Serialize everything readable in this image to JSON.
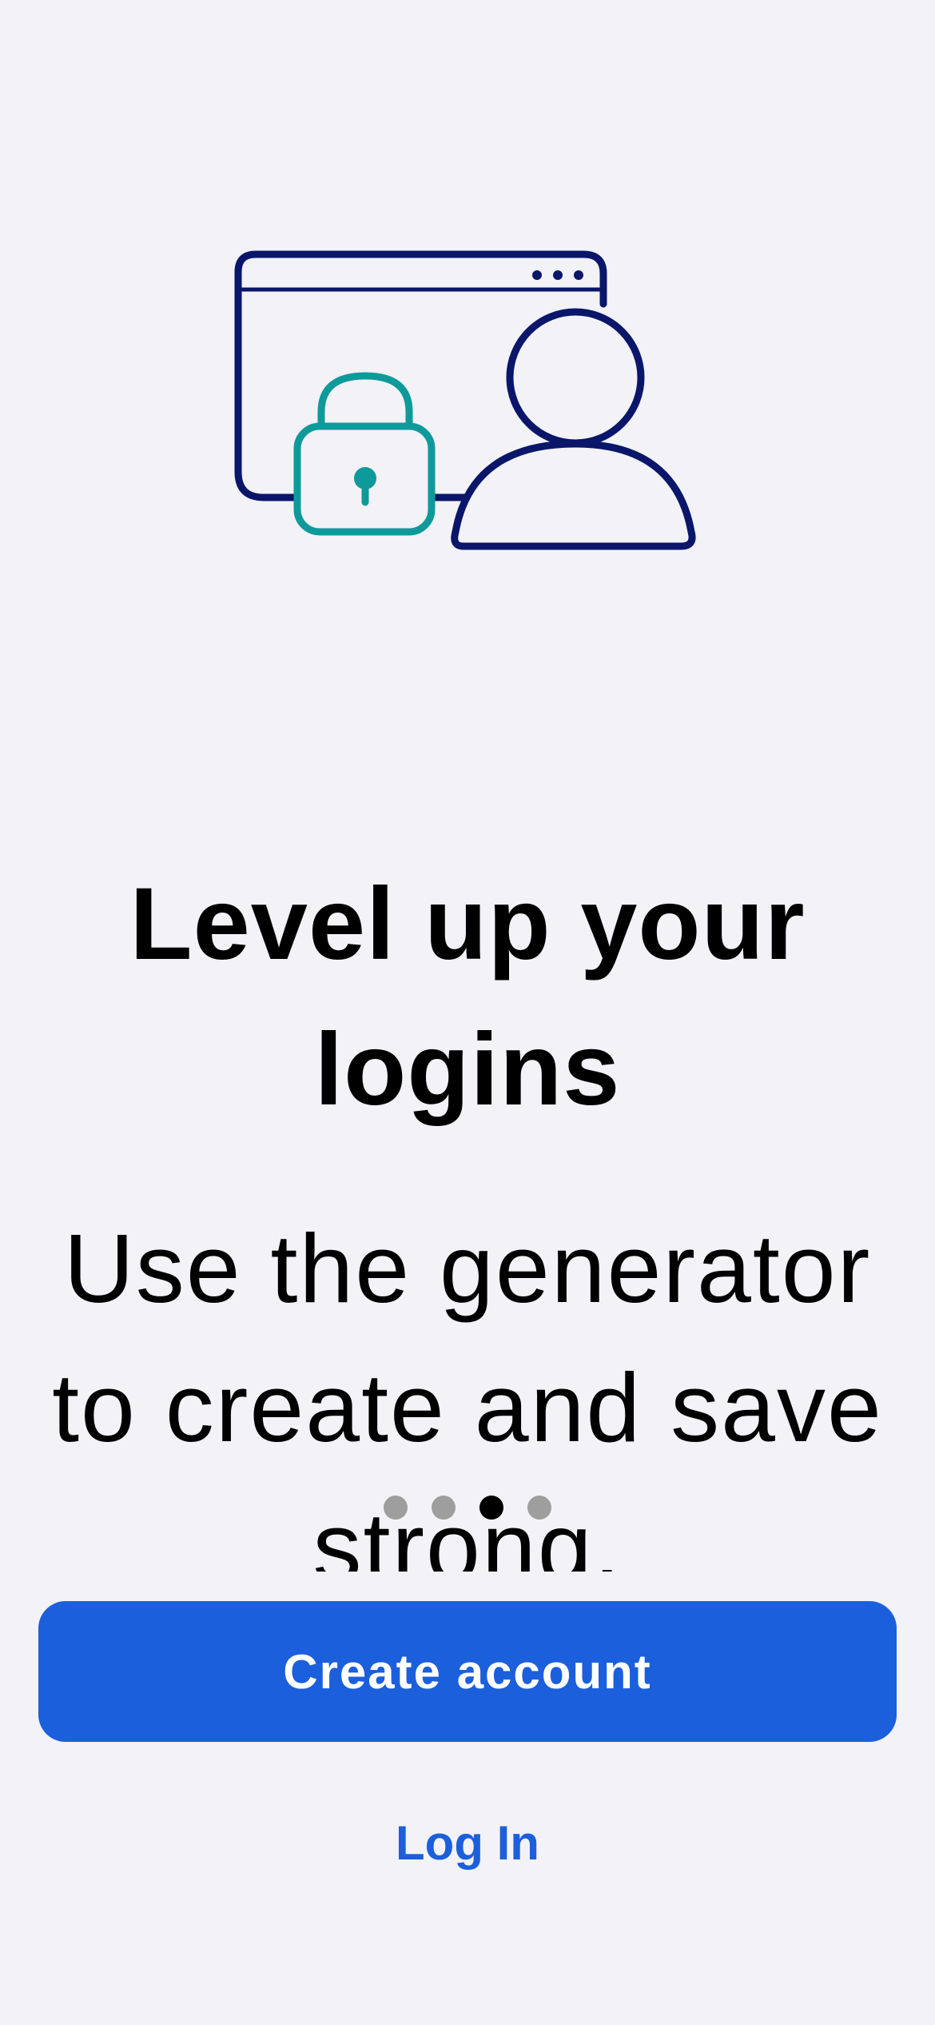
{
  "onboarding": {
    "headline": "Level up your logins",
    "subtitle": "Use the generator to create and save strong,",
    "illustration_icon": "browser-lock-user-illustration",
    "pager": {
      "total_pages": 4,
      "current_page": 3
    }
  },
  "actions": {
    "create_account_label": "Create account",
    "login_label": "Log In"
  },
  "colors": {
    "background": "#f2f2f7",
    "primary": "#1b5fdc",
    "illustration_navy": "#0a1669",
    "illustration_teal": "#0e9a9a",
    "dot_inactive": "#9e9e9e",
    "dot_active": "#000000"
  }
}
